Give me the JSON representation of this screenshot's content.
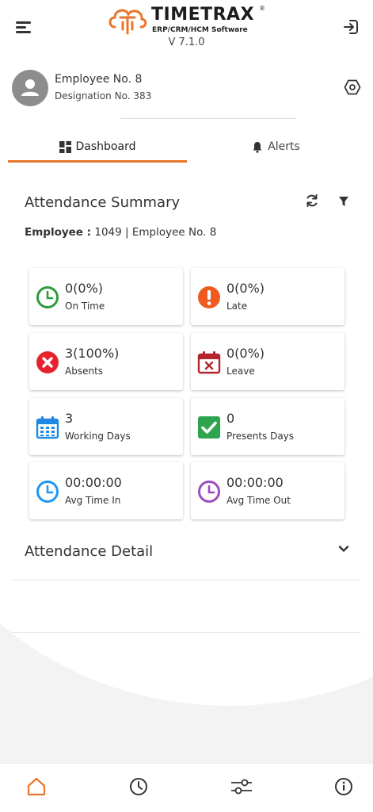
{
  "app": {
    "logo_text": "TIMETRAX",
    "logo_registered": "®",
    "logo_subtitle": "ERP/CRM/HCM Software",
    "version": "V 7.1.0"
  },
  "profile": {
    "name": "Employee No. 8",
    "designation": "Designation No. 383"
  },
  "tabs": [
    {
      "label": "Dashboard",
      "icon": "dashboard-grid-icon",
      "active": true
    },
    {
      "label": "Alerts",
      "icon": "bell-icon",
      "active": false
    }
  ],
  "summary": {
    "title": "Attendance Summary",
    "employee_label": "Employee :",
    "employee_value": "1049 | Employee No. 8",
    "stats": [
      {
        "value": "0(0%)",
        "label": "On Time",
        "icon": "clock-icon",
        "color": "#2e9b3a"
      },
      {
        "value": "0(0%)",
        "label": "Late",
        "icon": "exclamation-icon",
        "color": "#f05a1f"
      },
      {
        "value": "3(100%)",
        "label": "Absents",
        "icon": "cross-circle-icon",
        "color": "#e8212e"
      },
      {
        "value": "0(0%)",
        "label": "Leave",
        "icon": "calendar-x-icon",
        "color": "#b5242f"
      },
      {
        "value": "3",
        "label": "Working Days",
        "icon": "calendar-grid-icon",
        "color": "#1e88e5"
      },
      {
        "value": "0",
        "label": "Presents Days",
        "icon": "check-square-icon",
        "color": "#2ea44f"
      },
      {
        "value": "00:00:00",
        "label": "Avg Time In",
        "icon": "clock-icon",
        "color": "#2196f3"
      },
      {
        "value": "00:00:00",
        "label": "Avg Time Out",
        "icon": "clock-icon",
        "color": "#9c4fbf"
      }
    ]
  },
  "detail": {
    "title": "Attendance Detail"
  },
  "colors": {
    "accent": "#e8762b"
  },
  "bottom_nav": [
    {
      "name": "home-icon",
      "active": true
    },
    {
      "name": "clock-icon",
      "active": false
    },
    {
      "name": "sliders-icon",
      "active": false
    },
    {
      "name": "info-icon",
      "active": false
    }
  ]
}
